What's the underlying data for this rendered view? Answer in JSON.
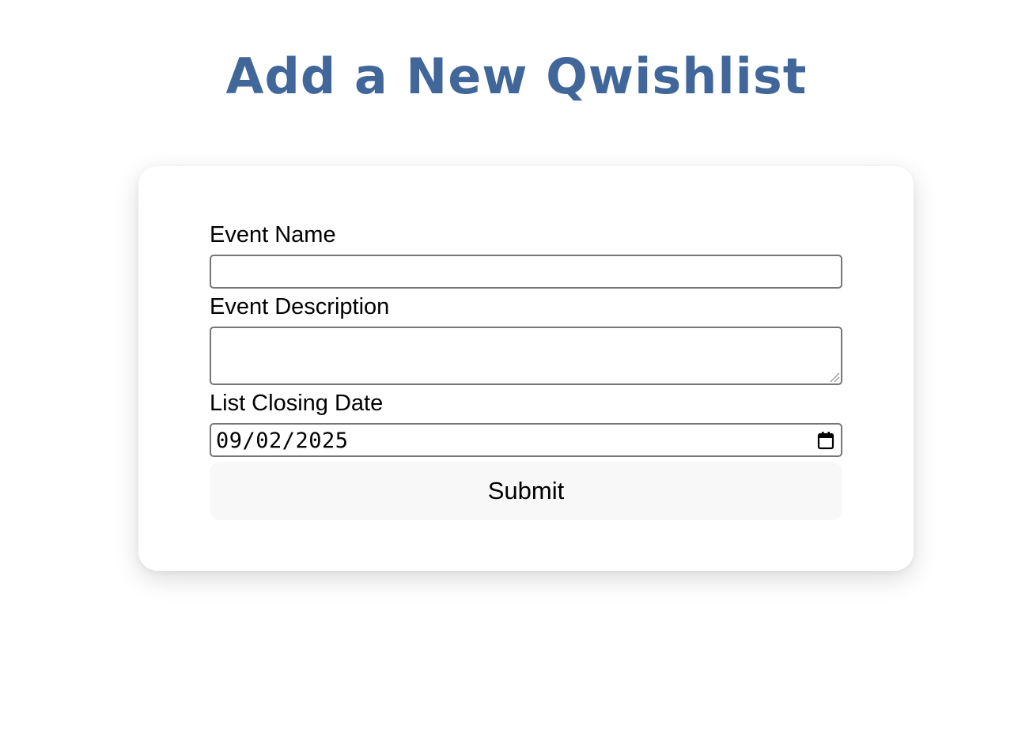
{
  "page": {
    "title": "Add a New Qwishlist"
  },
  "form": {
    "event_name": {
      "label": "Event Name",
      "value": ""
    },
    "event_description": {
      "label": "Event Description",
      "value": ""
    },
    "closing_date": {
      "label": "List Closing Date",
      "value": "09/02/2025",
      "icon": "calendar-icon"
    },
    "submit_label": "Submit"
  },
  "colors": {
    "title": "#41679a",
    "input_border": "#767676",
    "button_bg": "#f8f8f8",
    "card_bg": "#ffffff"
  }
}
